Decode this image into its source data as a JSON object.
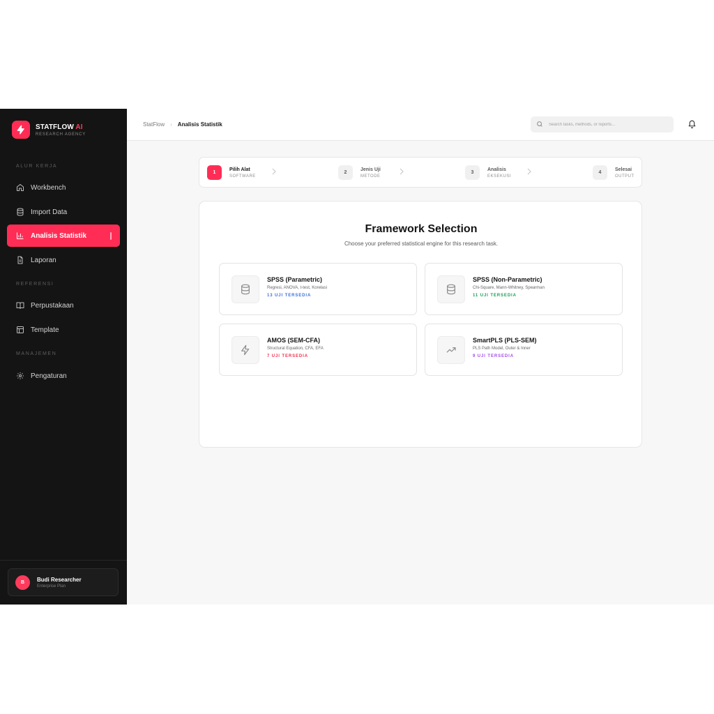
{
  "brand": {
    "name_main": "STATFLOW",
    "name_accent": "AI",
    "subtitle": "RESEARCH AGENCY"
  },
  "sidebar": {
    "sections": [
      {
        "label": "ALUR KERJA"
      },
      {
        "label": "REFERENSI"
      },
      {
        "label": "MANAJEMEN"
      }
    ],
    "items": [
      {
        "label": "Workbench",
        "icon": "home-icon"
      },
      {
        "label": "Import Data",
        "icon": "database-icon"
      },
      {
        "label": "Analisis Statistik",
        "icon": "bar-chart-icon",
        "active": true
      },
      {
        "label": "Laporan",
        "icon": "file-text-icon"
      },
      {
        "label": "Perpustakaan",
        "icon": "book-icon"
      },
      {
        "label": "Template",
        "icon": "layout-icon"
      },
      {
        "label": "Pengaturan",
        "icon": "gear-icon"
      }
    ]
  },
  "user": {
    "initial": "B",
    "name": "Budi Researcher",
    "plan": "Enterprise Plan"
  },
  "header": {
    "breadcrumb": {
      "root": "StatFlow",
      "separator": "›",
      "current": "Analisis Statistik"
    },
    "search": {
      "placeholder": "Search tasks, methods, or reports..."
    }
  },
  "steps": [
    {
      "number": "1",
      "title": "Pilih Alat",
      "subtitle": "SOFTWARE",
      "active": true
    },
    {
      "number": "2",
      "title": "Jenis Uji",
      "subtitle": "METODE",
      "active": false
    },
    {
      "number": "3",
      "title": "Analisis",
      "subtitle": "EKSEKUSI",
      "active": false
    },
    {
      "number": "4",
      "title": "Selesai",
      "subtitle": "OUTPUT",
      "active": false
    }
  ],
  "main": {
    "title": "Framework Selection",
    "subtitle": "Choose your preferred statistical engine for this research task.",
    "frameworks": [
      {
        "title": "SPSS (Parametric)",
        "description": "Regresi, ANOVA, t-test, Korelasi",
        "count": "13 UJI TERSEDIA",
        "color": "#3b6fe0",
        "icon": "database-icon"
      },
      {
        "title": "SPSS (Non-Parametric)",
        "description": "Chi-Square, Mann-Whitney, Spearman",
        "count": "11 UJI TERSEDIA",
        "color": "#18a058",
        "icon": "database-icon"
      },
      {
        "title": "AMOS (SEM-CFA)",
        "description": "Structural Equation, CFA, EFA",
        "count": "7 UJI TERSEDIA",
        "color": "#f0304f",
        "icon": "lightning-icon"
      },
      {
        "title": "SmartPLS (PLS-SEM)",
        "description": "PLS Path Model, Outer & Inner",
        "count": "9 UJI TERSEDIA",
        "color": "#a24ce8",
        "icon": "trending-up-icon"
      }
    ]
  },
  "colors": {
    "accent": "#ff2d55",
    "sidebar_bg": "#141414"
  }
}
